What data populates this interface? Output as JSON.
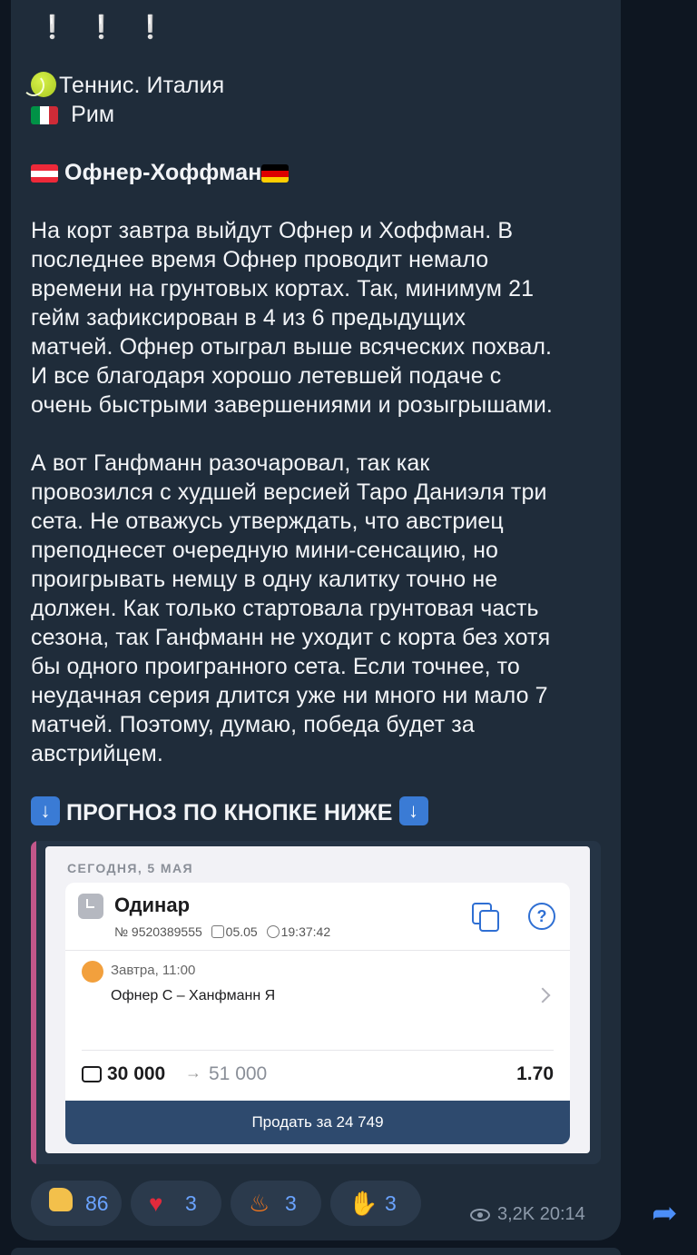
{
  "post": {
    "headline": "❕ ❕ ❕",
    "sport": "Теннис. Италия",
    "city": "Рим",
    "match_title": "Офнер-Хоффман",
    "paragraph1": [
      "На корт завтра выйдут Офнер и Хоффман. В",
      "последнее время Офнер проводит немало",
      "времени на грунтовых кортах. Так, минимум 21",
      "гейм зафиксирован в 4 из 6 предыдущих",
      "матчей. Офнер отыграл выше всяческих похвал.",
      "И все благодаря хорошо летевшей подаче с",
      "очень быстрыми завершениями и розыгрышами."
    ],
    "paragraph2": [
      "А вот Ганфманн разочаровал, так как",
      "провозился с худшей версией Таро Даниэля три",
      "сета. Не отважусь утверждать, что австриец",
      "преподнесет очередную мини-сенсацию, но",
      "проигрывать немцу в одну калитку точно не",
      "должен. Как только стартовала грунтовая часть",
      "сезона, так Ганфманн не уходит с корта без хотя",
      "бы одного проигранного сета. Если точнее, то",
      "неудачная серия длится уже ни много ни мало 7",
      "матчей. Поэтому, думаю, победа будет за",
      "австрийцем."
    ],
    "cta": "ПРОГНОЗ ПО КНОПКЕ НИЖЕ"
  },
  "bet_screenshot": {
    "date": "СЕГОДНЯ, 5 МАЯ",
    "type": "Одинар",
    "number": "№ 9520389555",
    "bet_date": "05.05",
    "bet_time": "19:37:42",
    "event_time": "Завтра, 11:00",
    "match": "Офнер С – Ханфманн Я",
    "stake": "30 000",
    "arrow": "→",
    "payout": "51 000",
    "odds": "1.70",
    "sell_button": "Продать за 24 749"
  },
  "reactions": [
    {
      "icon": "thumbs-up",
      "count": "86"
    },
    {
      "icon": "heart",
      "count": "3"
    },
    {
      "icon": "fire",
      "count": "3"
    },
    {
      "icon": "clap",
      "count": "3"
    }
  ],
  "footer": {
    "views": "3,2K",
    "time": "20:14"
  },
  "colors": {
    "background": "#0e1621",
    "bubble": "#1f2c3a",
    "accent": "#6aa3ff",
    "sell_button": "#2e4a6e"
  }
}
